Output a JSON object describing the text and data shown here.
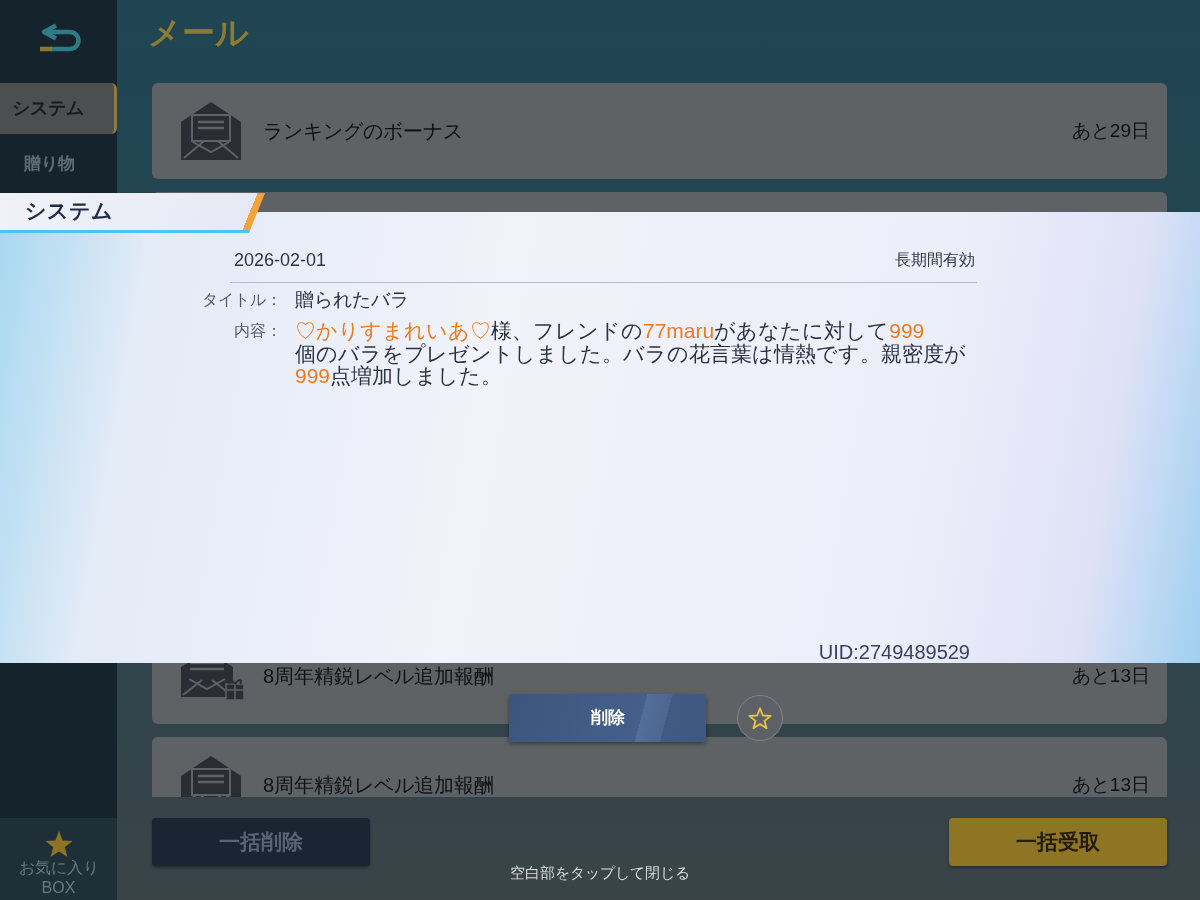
{
  "sidebar": {
    "items": [
      {
        "label": "システム",
        "selected": true
      },
      {
        "label": "贈り物",
        "selected": false
      }
    ],
    "favorites": {
      "label": "お気に入り BOX"
    }
  },
  "header": {
    "title": "メール"
  },
  "mail_list": [
    {
      "title": "ランキングのボーナス",
      "remaining": "あと29日",
      "kind": "letter"
    },
    {
      "title": "8周年精鋭レベル追加報酬",
      "remaining": "あと13日",
      "kind": "gift"
    },
    {
      "title": "8周年精鋭レベル追加報酬",
      "remaining": "あと13日",
      "kind": "letter"
    }
  ],
  "footer": {
    "buttons": [
      {
        "label": "一括削除",
        "kind": "delete"
      },
      {
        "label": "一括受取",
        "kind": "claim"
      }
    ]
  },
  "dialog": {
    "section": "システム",
    "date": "2026-02-01",
    "validity": "長期間有効",
    "title_label": "タイトル：",
    "title": "贈られたバラ",
    "content_label": "内容：",
    "content": [
      {
        "text": "♡かりすまれいあ♡",
        "highlight": true
      },
      {
        "text": "様、フレンドの",
        "highlight": false
      },
      {
        "text": "77maru",
        "highlight": true
      },
      {
        "text": "があなたに対して",
        "highlight": false
      },
      {
        "text": "999",
        "highlight": true
      },
      {
        "text": "\n個のバラをプレゼントしました。バラの花言葉は情熱です。親密度が\n",
        "highlight": false
      },
      {
        "text": "999",
        "highlight": true
      },
      {
        "text": "点増加しました。",
        "highlight": false
      }
    ],
    "uid": "UID:2749489529",
    "delete_button": "削除",
    "favorited": false,
    "close_hint": "空白部をタップして閉じる"
  }
}
